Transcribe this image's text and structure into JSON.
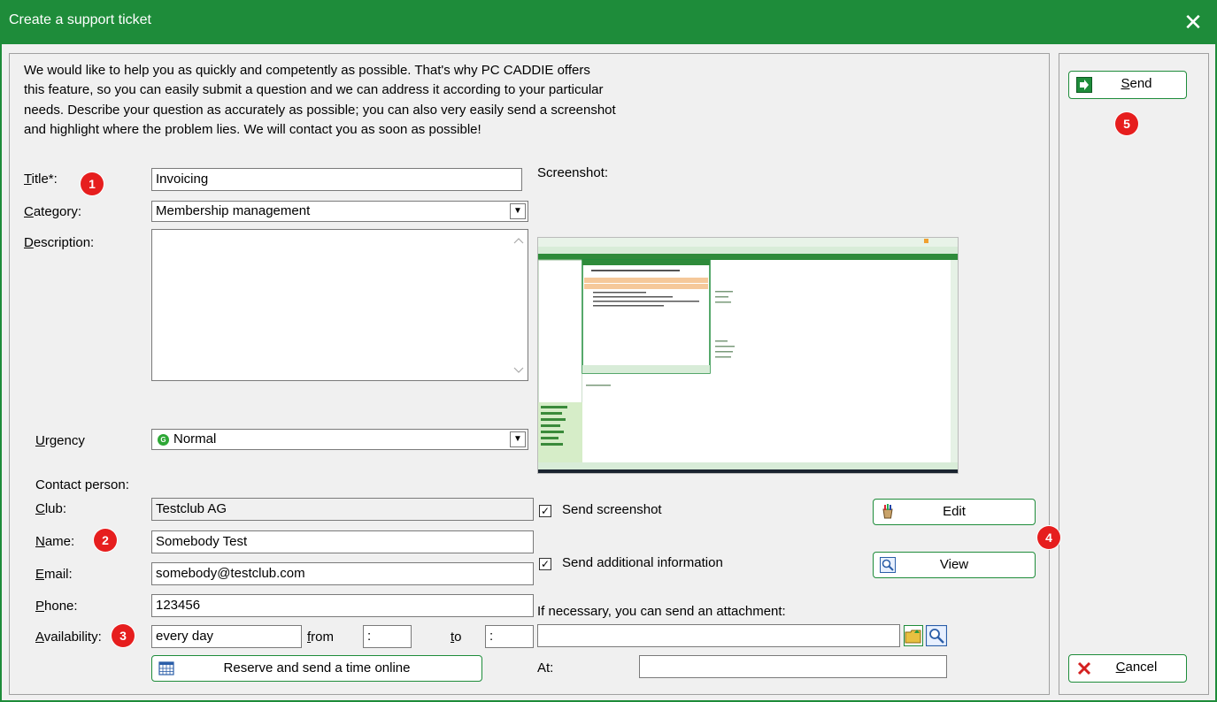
{
  "window": {
    "title": "Create a support ticket",
    "close_glyph": "✕"
  },
  "intro": {
    "line1": "We would like to help you as quickly and competently as possible. That's why PC CADDIE offers",
    "line2": "this feature, so you can easily submit a question and we can address it according to your particular",
    "line3": "needs. Describe your question as accurately as possible; you can also very easily send a screenshot",
    "line4": "and highlight where the problem lies. We will contact you as soon as possible!"
  },
  "form": {
    "title_label": {
      "key": "T",
      "rest": "itle*:"
    },
    "title_value": "Invoicing",
    "category_label": {
      "key": "C",
      "rest": "ategory:"
    },
    "category_value": "Membership management",
    "description_label": {
      "key": "D",
      "rest": "escription:"
    },
    "description_value": "",
    "urgency_label": {
      "key": "U",
      "rest": "rgency"
    },
    "urgency_value": "Normal",
    "urgency_icon_letter": "G"
  },
  "contact": {
    "heading": "Contact person:",
    "club_label": {
      "key": "C",
      "rest": "lub:"
    },
    "club_value": "Testclub AG",
    "name_label": {
      "key": "N",
      "rest": "ame:"
    },
    "name_value": "Somebody Test",
    "email_label": {
      "key": "E",
      "rest": "mail:"
    },
    "email_value": "somebody@testclub.com",
    "phone_label": {
      "key": "P",
      "rest": "hone:"
    },
    "phone_value": "123456",
    "availability_label": {
      "key": "A",
      "rest": "vailability:"
    },
    "availability_value": "every day",
    "from_label": {
      "key": "f",
      "rest": "rom"
    },
    "from_value": ":",
    "to_label": {
      "key": "t",
      "rest": "o"
    },
    "to_value": ":",
    "reserve_button": "Reserve and send a time online"
  },
  "screenshot": {
    "label": "Screenshot:",
    "send_screenshot_label": "Send screenshot",
    "send_screenshot_checked": "✓",
    "send_additional_label": "Send additional information",
    "send_additional_checked": "✓",
    "edit_button": "Edit",
    "view_button": "View",
    "attachment_label": "If necessary, you can send an attachment:",
    "attachment_value": "",
    "at_label": "At:",
    "at_value": ""
  },
  "side": {
    "send_button": {
      "key": "S",
      "rest": "end"
    },
    "cancel_button": {
      "key": "C",
      "rest": "ancel"
    }
  },
  "badges": {
    "b1": "1",
    "b2": "2",
    "b3": "3",
    "b4": "4",
    "b5": "5"
  },
  "colors": {
    "titlebar": "#1e8c3a",
    "badge": "#e61e1e",
    "button_border": "#1e8c3a"
  }
}
